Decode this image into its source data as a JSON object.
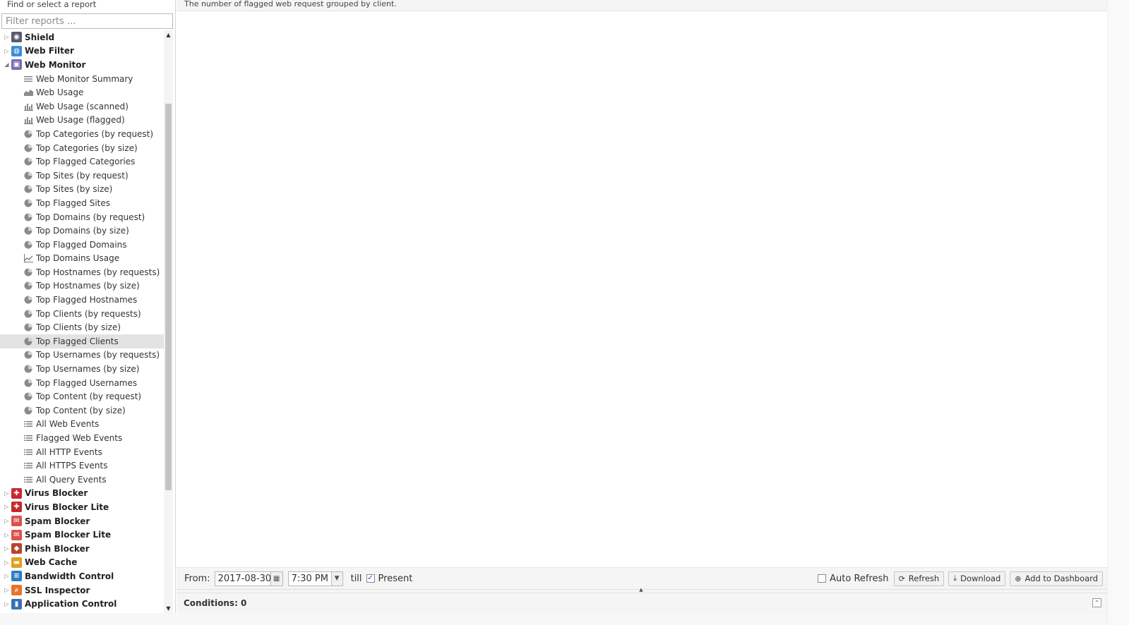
{
  "left_panel": {
    "title": "Find or select a report",
    "filter_placeholder": "Filter reports ...",
    "apps_before": [
      {
        "label": "Shield",
        "icon": "shield-icon",
        "color": "#5a5a6e",
        "glyph": "◉"
      },
      {
        "label": "Web Filter",
        "icon": "web-filter-icon",
        "color": "#3a8fd6",
        "glyph": "◍"
      }
    ],
    "expanded_app": {
      "label": "Web Monitor",
      "icon": "web-monitor-icon",
      "color": "#7a6bb8",
      "glyph": "▣"
    },
    "reports": [
      {
        "label": "Web Monitor Summary",
        "icon": "text-lines-icon"
      },
      {
        "label": "Web Usage",
        "icon": "area-chart-icon"
      },
      {
        "label": "Web Usage (scanned)",
        "icon": "bar-chart-icon"
      },
      {
        "label": "Web Usage (flagged)",
        "icon": "bar-chart-icon"
      },
      {
        "label": "Top Categories (by request)",
        "icon": "pie-chart-icon"
      },
      {
        "label": "Top Categories (by size)",
        "icon": "pie-chart-icon"
      },
      {
        "label": "Top Flagged Categories",
        "icon": "pie-chart-icon"
      },
      {
        "label": "Top Sites (by request)",
        "icon": "pie-chart-icon"
      },
      {
        "label": "Top Sites (by size)",
        "icon": "pie-chart-icon"
      },
      {
        "label": "Top Flagged Sites",
        "icon": "pie-chart-icon"
      },
      {
        "label": "Top Domains (by request)",
        "icon": "pie-chart-icon"
      },
      {
        "label": "Top Domains (by size)",
        "icon": "pie-chart-icon"
      },
      {
        "label": "Top Flagged Domains",
        "icon": "pie-chart-icon"
      },
      {
        "label": "Top Domains Usage",
        "icon": "line-chart-icon"
      },
      {
        "label": "Top Hostnames (by requests)",
        "icon": "pie-chart-icon"
      },
      {
        "label": "Top Hostnames (by size)",
        "icon": "pie-chart-icon"
      },
      {
        "label": "Top Flagged Hostnames",
        "icon": "pie-chart-icon"
      },
      {
        "label": "Top Clients (by requests)",
        "icon": "pie-chart-icon"
      },
      {
        "label": "Top Clients (by size)",
        "icon": "pie-chart-icon"
      },
      {
        "label": "Top Flagged Clients",
        "icon": "pie-chart-icon",
        "selected": true
      },
      {
        "label": "Top Usernames (by requests)",
        "icon": "pie-chart-icon"
      },
      {
        "label": "Top Usernames (by size)",
        "icon": "pie-chart-icon"
      },
      {
        "label": "Top Flagged Usernames",
        "icon": "pie-chart-icon"
      },
      {
        "label": "Top Content (by request)",
        "icon": "pie-chart-icon"
      },
      {
        "label": "Top Content (by size)",
        "icon": "pie-chart-icon"
      },
      {
        "label": "All Web Events",
        "icon": "list-icon"
      },
      {
        "label": "Flagged Web Events",
        "icon": "list-icon"
      },
      {
        "label": "All HTTP Events",
        "icon": "list-icon"
      },
      {
        "label": "All HTTPS Events",
        "icon": "list-icon"
      },
      {
        "label": "All Query Events",
        "icon": "list-icon"
      }
    ],
    "apps_after": [
      {
        "label": "Virus Blocker",
        "icon": "virus-blocker-icon",
        "color": "#c8282d",
        "glyph": "✚"
      },
      {
        "label": "Virus Blocker Lite",
        "icon": "virus-blocker-lite-icon",
        "color": "#c8282d",
        "glyph": "✚"
      },
      {
        "label": "Spam Blocker",
        "icon": "spam-blocker-icon",
        "color": "#d9534f",
        "glyph": "✉"
      },
      {
        "label": "Spam Blocker Lite",
        "icon": "spam-blocker-lite-icon",
        "color": "#d9534f",
        "glyph": "✉"
      },
      {
        "label": "Phish Blocker",
        "icon": "phish-blocker-icon",
        "color": "#b5452f",
        "glyph": "◆"
      },
      {
        "label": "Web Cache",
        "icon": "web-cache-icon",
        "color": "#e0a020",
        "glyph": "▬"
      },
      {
        "label": "Bandwidth Control",
        "icon": "bandwidth-control-icon",
        "color": "#2f7fc0",
        "glyph": "≡"
      },
      {
        "label": "SSL Inspector",
        "icon": "ssl-inspector-icon",
        "color": "#e8732a",
        "glyph": "⌕"
      },
      {
        "label": "Application Control",
        "icon": "application-control-icon",
        "color": "#3b6fb6",
        "glyph": "▮"
      }
    ]
  },
  "report": {
    "description": "The number of flagged web request grouped by client."
  },
  "toolbar": {
    "from_label": "From:",
    "from_date": "2017-08-30",
    "from_time": "7:30 PM",
    "till_label": "till",
    "present_label": "Present",
    "present_checked": true,
    "auto_refresh_label": "Auto Refresh",
    "auto_refresh_checked": false,
    "refresh_label": "Refresh",
    "download_label": "Download",
    "add_dashboard_label": "Add to Dashboard"
  },
  "conditions": {
    "label": "Conditions: 0"
  }
}
